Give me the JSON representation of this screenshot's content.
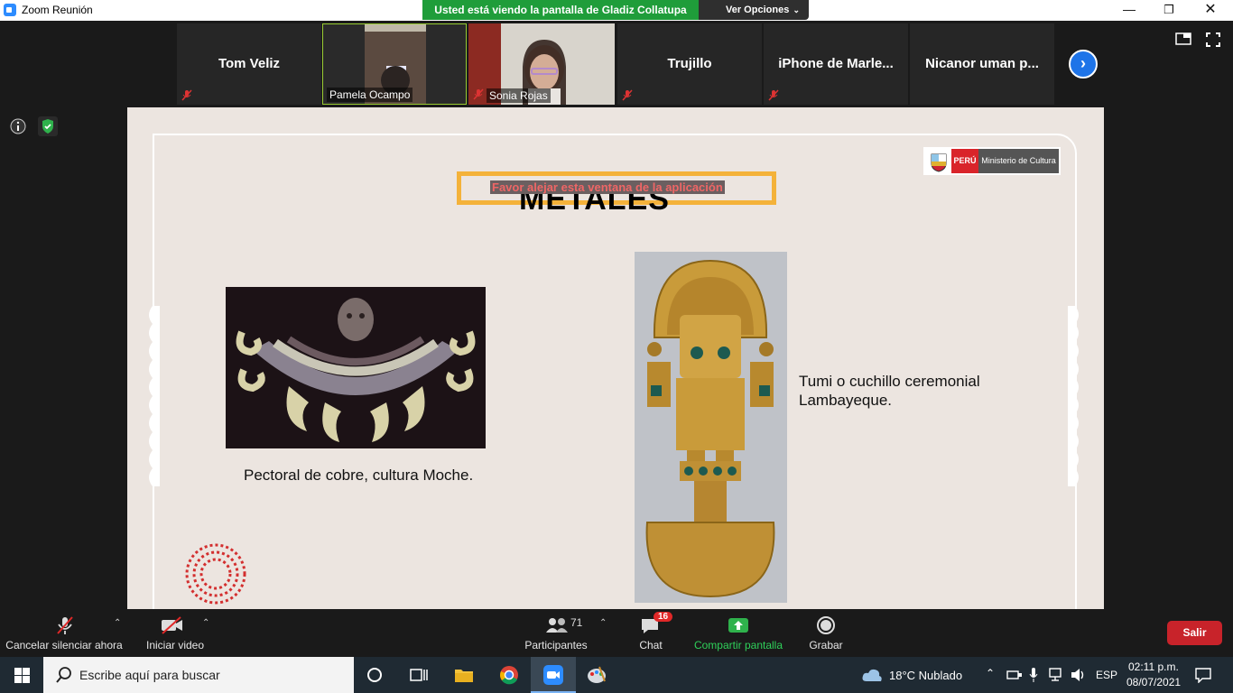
{
  "window": {
    "title": "Zoom Reunión",
    "share_banner": "Usted está viendo la pantalla de Gladiz Collatupa",
    "view_options": "Ver Opciones"
  },
  "participants_strip": [
    {
      "name": "Tom Veliz",
      "muted": true,
      "video": false
    },
    {
      "name": "Pamela Ocampo",
      "muted": false,
      "video": true,
      "active_speaker": true
    },
    {
      "name": "Sonia Rojas",
      "muted": true,
      "video": true
    },
    {
      "name": "Trujillo",
      "muted": true,
      "video": false
    },
    {
      "name": "iPhone de Marle...",
      "muted": true,
      "video": false
    },
    {
      "name": "Nicanor uman p...",
      "muted": false,
      "video": false
    }
  ],
  "slide": {
    "warning_overlay": "Favor alejar esta ventana de la aplicación",
    "title": "METALES",
    "logo": {
      "country": "PERÚ",
      "ministry": "Ministerio de Cultura"
    },
    "left_caption": "Pectoral de cobre, cultura Moche.",
    "right_caption_line1": "Tumi o cuchillo ceremonial",
    "right_caption_line2": "Lambayeque."
  },
  "toolbar": {
    "unmute": "Cancelar silenciar ahora",
    "start_video": "Iniciar video",
    "participants": "Participantes",
    "participants_count": "71",
    "chat": "Chat",
    "chat_badge": "16",
    "share_screen": "Compartir pantalla",
    "record": "Grabar",
    "leave": "Salir"
  },
  "taskbar": {
    "search_placeholder": "Escribe aquí para buscar",
    "weather": "18°C  Nublado",
    "language": "ESP",
    "time": "02:11 p.m.",
    "date": "08/07/2021"
  },
  "colors": {
    "share_green": "#1f9d3a",
    "leave_red": "#c8232a",
    "zoom_blue": "#1e74e8",
    "slide_bg": "#ece5e0"
  }
}
